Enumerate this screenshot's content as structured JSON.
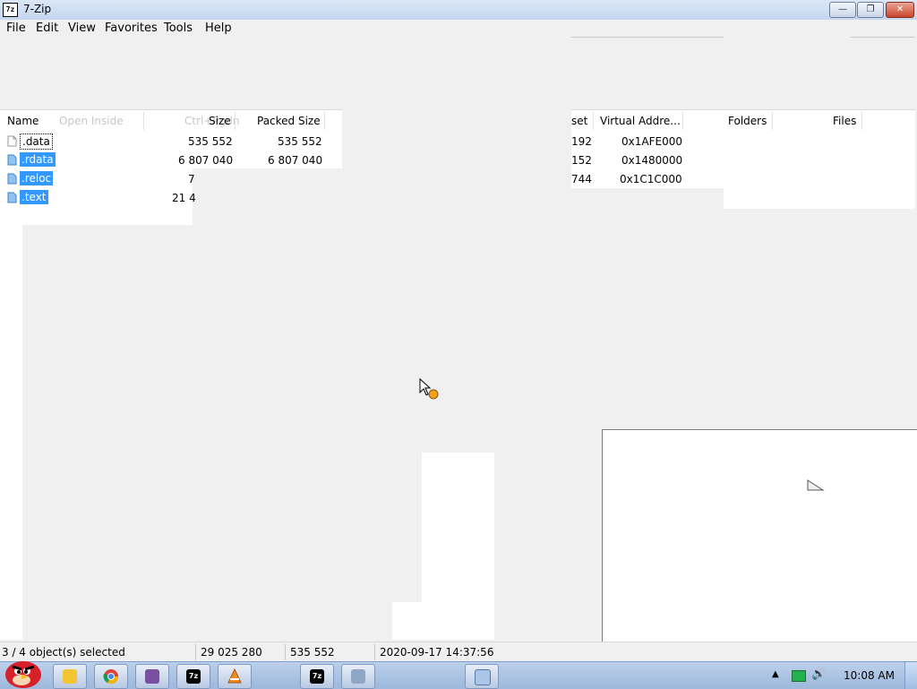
{
  "window": {
    "title": "7-Zip",
    "app_icon": "7z"
  },
  "menu": [
    "File",
    "Edit",
    "View",
    "Favorites",
    "Tools",
    "Help"
  ],
  "ghost_menu": {
    "open_inside": "Open Inside",
    "shortcut": "Ctrl+Pgdn"
  },
  "columns": {
    "name": "Name",
    "size": "Size",
    "packed": "Packed Size",
    "offset": "set",
    "virtual_address": "Virtual Addre...",
    "folders": "Folders",
    "files": "Files"
  },
  "rows": [
    {
      "name": ".data",
      "size": "535 552",
      "packed": "535 552",
      "offset": "192",
      "vaddr": "0x1AFE000",
      "selected": false,
      "focused": true
    },
    {
      "name": ".rdata",
      "size": "6 807 040",
      "packed": "6 807 040",
      "offset": "152",
      "vaddr": "0x1480000",
      "selected": true,
      "focused": false
    },
    {
      "name": ".reloc",
      "size": "7",
      "packed": "",
      "offset": "744",
      "vaddr": "0x1C1C000",
      "selected": true,
      "focused": false
    },
    {
      "name": ".text",
      "size": "21 4",
      "packed": "",
      "offset": "",
      "vaddr": "",
      "selected": true,
      "focused": false
    }
  ],
  "status": {
    "selection": "3 / 4 object(s) selected",
    "total_size": "29 025 280",
    "selected_size": "535 552",
    "date": "2020-09-17 14:37:56"
  },
  "taskbar": {
    "apps": [
      "explorer",
      "chrome",
      "app-purple",
      "7zip",
      "vlc",
      "7zip-active",
      "notepad-active",
      "file-active"
    ],
    "clock": "10:08 AM"
  },
  "colors": {
    "selection": "#3399ff",
    "taskbar": "#9db8dc"
  }
}
